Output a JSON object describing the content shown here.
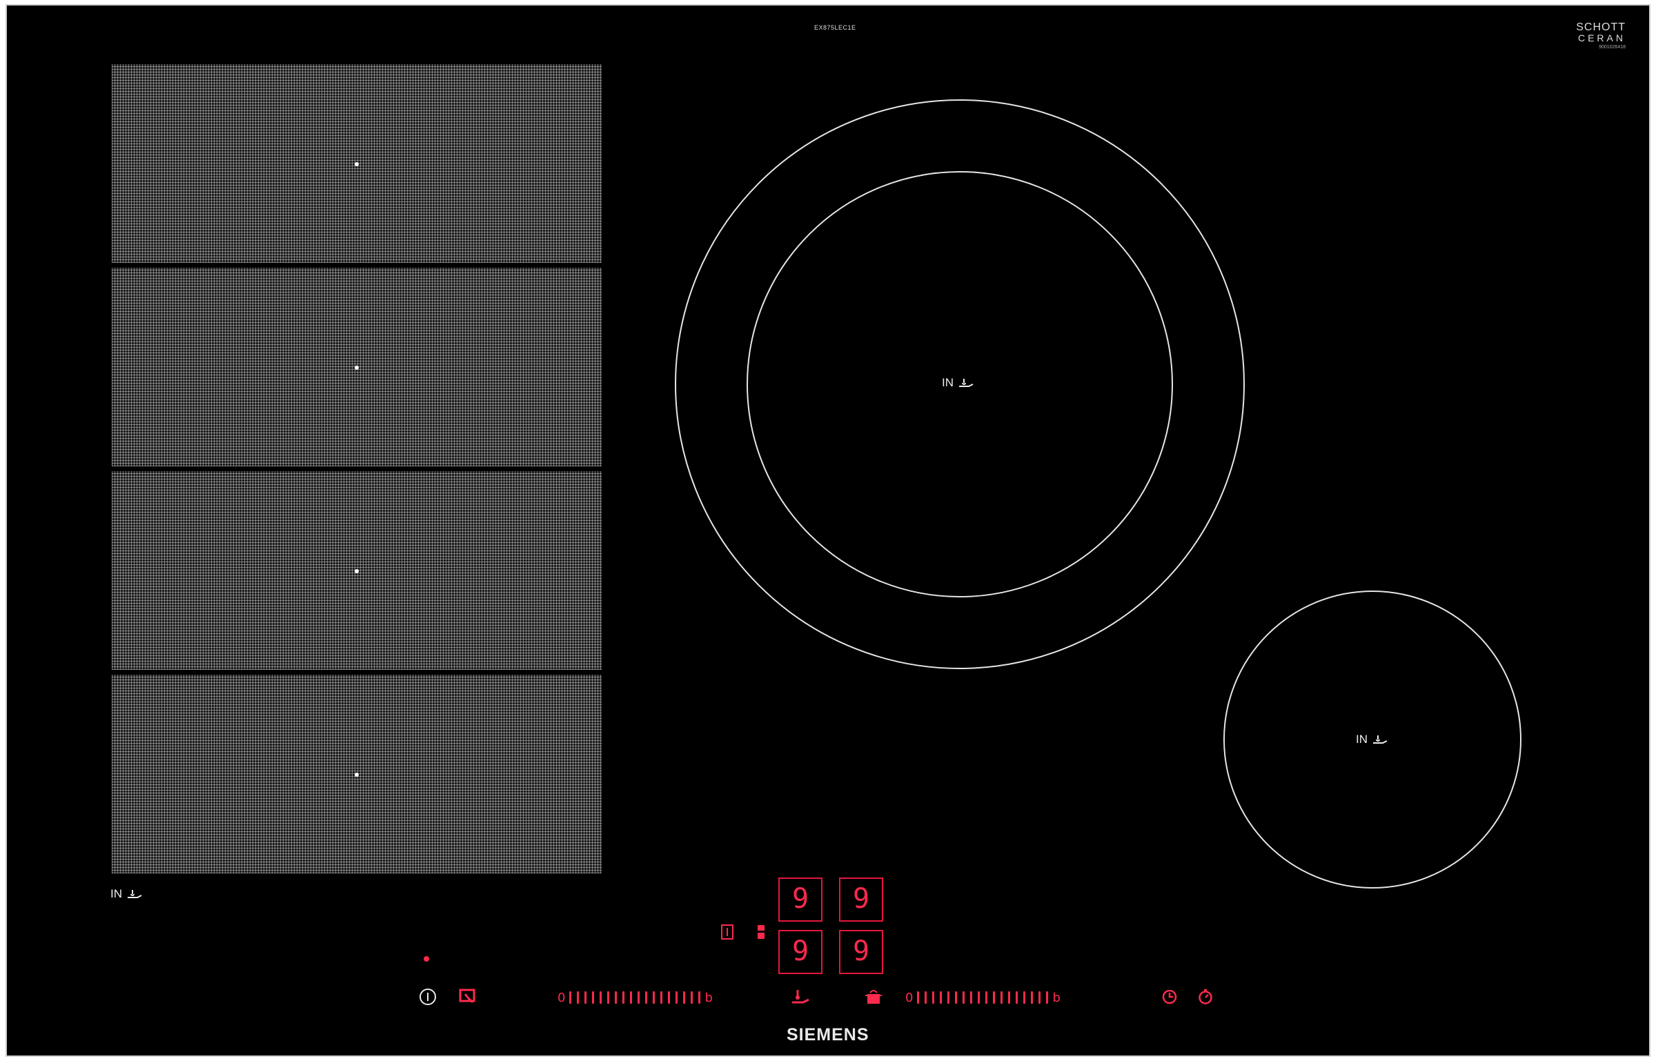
{
  "hob": {
    "model": "EX875LEC1E",
    "glass_brand_line1": "SCHOTT",
    "glass_brand_line2": "CERAN",
    "glass_serial": "9001026418",
    "brand": "SIEMENS"
  },
  "zones": {
    "flex_label": "IN",
    "large_label": "IN",
    "small_label": "IN"
  },
  "displays": {
    "front_left": "9",
    "front_right": "9",
    "rear_left": "9",
    "rear_right": "9"
  },
  "sliders": {
    "left_min": "0",
    "left_max": "b",
    "right_min": "0",
    "right_max": "b",
    "steps": 18
  },
  "colors": {
    "accent": "#ff2a4d",
    "glass": "#000000",
    "print": "#e6e6e6"
  },
  "icons": {
    "power": "power-icon",
    "child_lock": "child-lock-icon",
    "wipe": "wipe-protection-icon",
    "flex": "flex-zone-icon",
    "pan": "frying-sensor-icon",
    "pot": "power-boost-icon",
    "timer": "timer-icon",
    "stopwatch": "stopwatch-icon"
  }
}
